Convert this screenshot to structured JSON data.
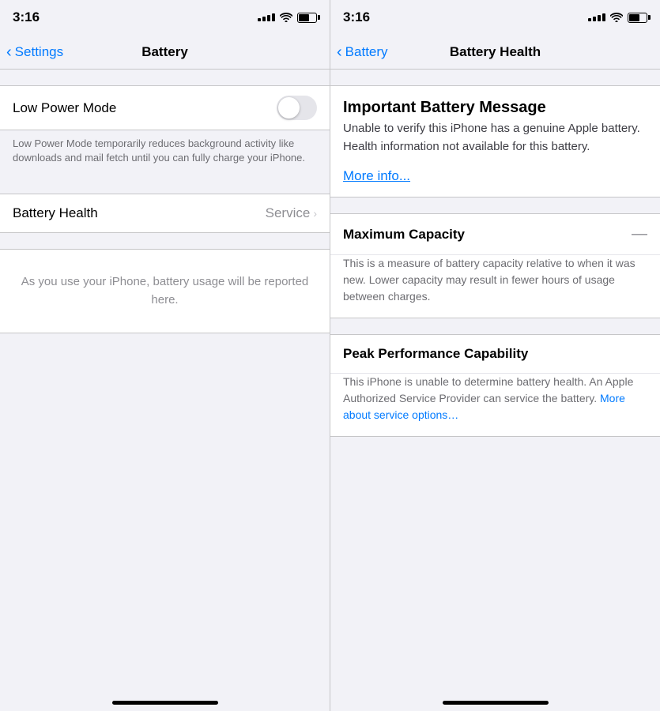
{
  "left": {
    "statusBar": {
      "time": "3:16"
    },
    "navBar": {
      "backLabel": "Settings",
      "title": "Battery"
    },
    "lowPowerMode": {
      "label": "Low Power Mode",
      "description": "Low Power Mode temporarily reduces background activity like downloads and mail fetch until you can fully charge your iPhone."
    },
    "batteryHealth": {
      "label": "Battery Health",
      "value": "Service",
      "chevron": "›"
    },
    "usageEmpty": {
      "text": "As you use your iPhone, battery usage will be reported here."
    }
  },
  "right": {
    "statusBar": {
      "time": "3:16"
    },
    "navBar": {
      "backLabel": "Battery",
      "title": "Battery Health"
    },
    "importantMessage": {
      "title": "Important Battery Message",
      "description": "Unable to verify this iPhone has a genuine Apple battery. Health information not available for this battery.",
      "link": "More info..."
    },
    "maximumCapacity": {
      "title": "Maximum Capacity",
      "dash": "—",
      "description": "This is a measure of battery capacity relative to when it was new. Lower capacity may result in fewer hours of usage between charges."
    },
    "peakPerformance": {
      "title": "Peak Performance Capability",
      "descriptionPart1": "This iPhone is unable to determine battery health. An Apple Authorized Service Provider can service the battery.",
      "link": "More about service options…"
    }
  }
}
